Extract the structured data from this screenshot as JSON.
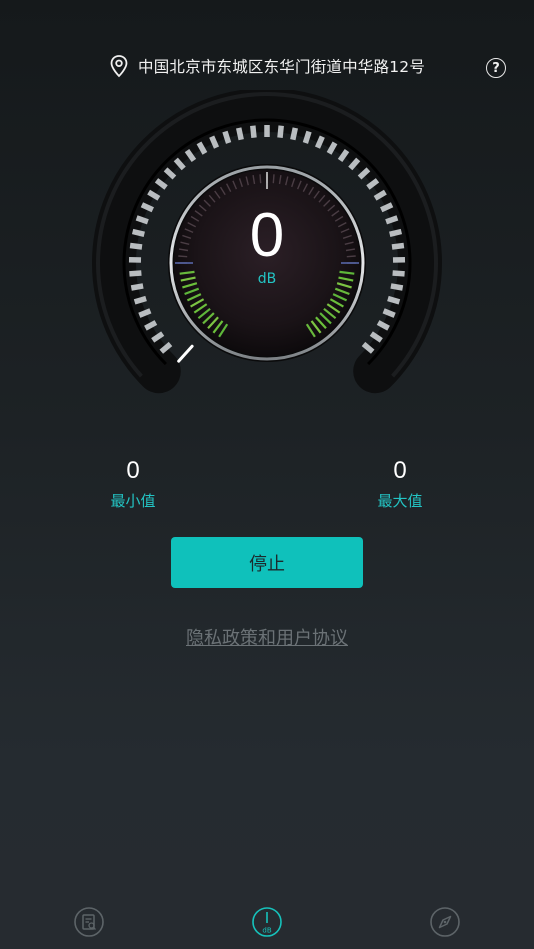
{
  "header": {
    "location": "中国北京市东城区东华门街道中华路12号",
    "location_icon": "map-pin-icon",
    "help_icon": "question-mark-icon",
    "help_symbol": "?"
  },
  "meter": {
    "value": "0",
    "unit": "dB"
  },
  "stats": {
    "min_value": "0",
    "min_label": "最小值",
    "max_value": "0",
    "max_label": "最大值"
  },
  "actions": {
    "stop_label": "停止"
  },
  "links": {
    "privacy": "隐私政策和用户协议"
  },
  "bottom_nav": {
    "items": [
      {
        "icon": "records-icon",
        "active": false
      },
      {
        "icon": "decibel-meter-icon",
        "label": "dB",
        "active": true
      },
      {
        "icon": "compass-icon",
        "active": false
      }
    ]
  },
  "colors": {
    "accent": "#0fc1bb",
    "accent_text": "#23c4c4",
    "level_green": "#6bbf3b",
    "background": "#1d2225"
  }
}
